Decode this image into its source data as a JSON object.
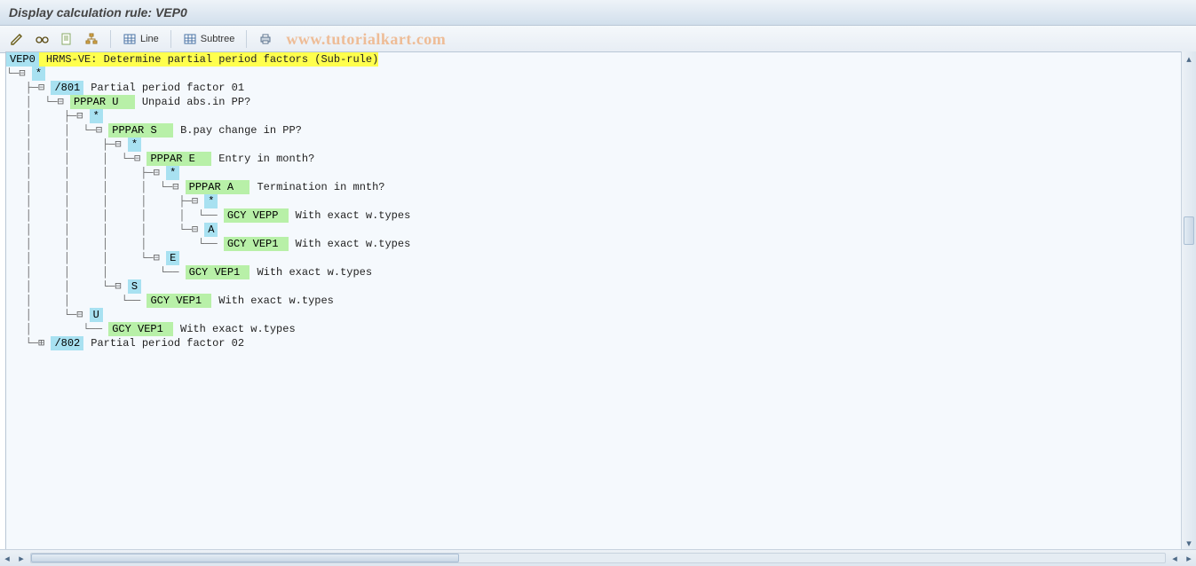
{
  "title": "Display calculation rule: VEP0",
  "watermark": "www.tutorialkart.com",
  "toolbar": {
    "line_label": "Line",
    "subtree_label": "Subtree"
  },
  "rows": [
    {
      "indent": 0,
      "conn": "",
      "node": "VEP0",
      "node_hi": "blu",
      "desc": "HRMS-VE: Determine partial period factors (Sub-rule)",
      "desc_hi": "yel"
    },
    {
      "indent": 0,
      "conn": "└─⊟ ",
      "node": "*",
      "node_hi": "blu"
    },
    {
      "indent": 1,
      "conn": "├─⊟ ",
      "node": "/801",
      "node_hi": "blu",
      "desc": "Partial period factor 01"
    },
    {
      "indent": 1,
      "conn": "│  └─⊟ ",
      "node": "PPPAR U  ",
      "node_hi": "grn",
      "desc": "Unpaid abs.in PP?"
    },
    {
      "indent": 1,
      "conn": "│     ├─⊟ ",
      "node": "*",
      "node_hi": "blu"
    },
    {
      "indent": 1,
      "conn": "│     │  └─⊟ ",
      "node": "PPPAR S  ",
      "node_hi": "grn",
      "desc": "B.pay change in PP?"
    },
    {
      "indent": 1,
      "conn": "│     │     ├─⊟ ",
      "node": "*",
      "node_hi": "blu"
    },
    {
      "indent": 1,
      "conn": "│     │     │  └─⊟ ",
      "node": "PPPAR E  ",
      "node_hi": "grn",
      "desc": "Entry in month?"
    },
    {
      "indent": 1,
      "conn": "│     │     │     ├─⊟ ",
      "node": "*",
      "node_hi": "blu"
    },
    {
      "indent": 1,
      "conn": "│     │     │     │  └─⊟ ",
      "node": "PPPAR A  ",
      "node_hi": "grn",
      "desc": "Termination in mnth?"
    },
    {
      "indent": 1,
      "conn": "│     │     │     │     ├─⊟ ",
      "node": "*",
      "node_hi": "blu"
    },
    {
      "indent": 1,
      "conn": "│     │     │     │     │  └── ",
      "node": "GCY VEPP ",
      "node_hi": "grn",
      "desc": "With exact w.types"
    },
    {
      "indent": 1,
      "conn": "│     │     │     │     └─⊟ ",
      "node": "A",
      "node_hi": "blu"
    },
    {
      "indent": 1,
      "conn": "│     │     │     │        └── ",
      "node": "GCY VEP1 ",
      "node_hi": "grn",
      "desc": "With exact w.types"
    },
    {
      "indent": 1,
      "conn": "│     │     │     └─⊟ ",
      "node": "E",
      "node_hi": "blu"
    },
    {
      "indent": 1,
      "conn": "│     │     │        └── ",
      "node": "GCY VEP1 ",
      "node_hi": "grn",
      "desc": "With exact w.types"
    },
    {
      "indent": 1,
      "conn": "│     │     └─⊟ ",
      "node": "S",
      "node_hi": "blu"
    },
    {
      "indent": 1,
      "conn": "│     │        └── ",
      "node": "GCY VEP1 ",
      "node_hi": "grn",
      "desc": "With exact w.types"
    },
    {
      "indent": 1,
      "conn": "│     └─⊟ ",
      "node": "U",
      "node_hi": "blu"
    },
    {
      "indent": 1,
      "conn": "│        └── ",
      "node": "GCY VEP1 ",
      "node_hi": "grn",
      "desc": "With exact w.types"
    },
    {
      "indent": 1,
      "conn": "└─⊞ ",
      "node": "/802",
      "node_hi": "blu",
      "desc": "Partial period factor 02"
    }
  ]
}
